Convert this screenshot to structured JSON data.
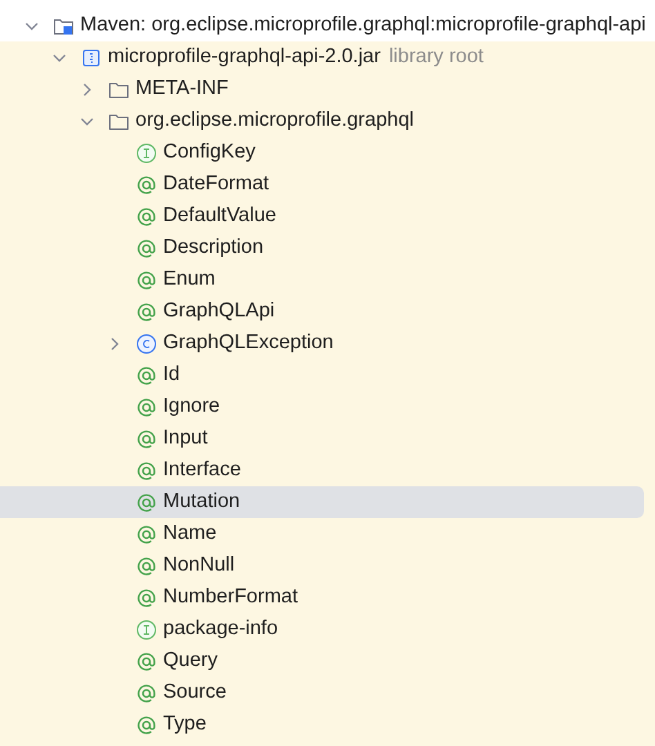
{
  "tree": [
    {
      "label": "Maven: org.eclipse.microprofile.graphql:microprofile-graphql-api",
      "kind": "library",
      "expanded": true,
      "selected": false,
      "children": [
        {
          "label": "microprofile-graphql-api-2.0.jar",
          "note": "library root",
          "kind": "jar",
          "expanded": true,
          "selected": false,
          "children": [
            {
              "label": "META-INF",
              "kind": "folder",
              "expanded": false,
              "selected": false
            },
            {
              "label": "org.eclipse.microprofile.graphql",
              "kind": "folder",
              "expanded": true,
              "selected": false,
              "children": [
                {
                  "label": "ConfigKey",
                  "kind": "interface",
                  "selected": false
                },
                {
                  "label": "DateFormat",
                  "kind": "annotation",
                  "selected": false
                },
                {
                  "label": "DefaultValue",
                  "kind": "annotation",
                  "selected": false
                },
                {
                  "label": "Description",
                  "kind": "annotation",
                  "selected": false
                },
                {
                  "label": "Enum",
                  "kind": "annotation",
                  "selected": false
                },
                {
                  "label": "GraphQLApi",
                  "kind": "annotation",
                  "selected": false
                },
                {
                  "label": "GraphQLException",
                  "kind": "class",
                  "expanded": false,
                  "selected": false
                },
                {
                  "label": "Id",
                  "kind": "annotation",
                  "selected": false
                },
                {
                  "label": "Ignore",
                  "kind": "annotation",
                  "selected": false
                },
                {
                  "label": "Input",
                  "kind": "annotation",
                  "selected": false
                },
                {
                  "label": "Interface",
                  "kind": "annotation",
                  "selected": false
                },
                {
                  "label": "Mutation",
                  "kind": "annotation",
                  "selected": true
                },
                {
                  "label": "Name",
                  "kind": "annotation",
                  "selected": false
                },
                {
                  "label": "NonNull",
                  "kind": "annotation",
                  "selected": false
                },
                {
                  "label": "NumberFormat",
                  "kind": "annotation",
                  "selected": false
                },
                {
                  "label": "package-info",
                  "kind": "interface",
                  "selected": false
                },
                {
                  "label": "Query",
                  "kind": "annotation",
                  "selected": false
                },
                {
                  "label": "Source",
                  "kind": "annotation",
                  "selected": false
                },
                {
                  "label": "Type",
                  "kind": "annotation",
                  "selected": false
                }
              ]
            }
          ]
        }
      ]
    }
  ]
}
